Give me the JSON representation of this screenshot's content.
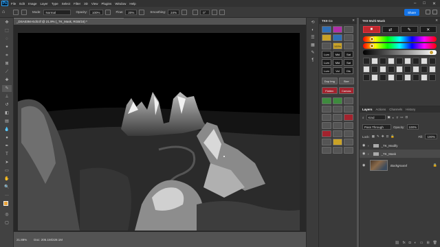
{
  "menubar": {
    "logo": "Ps",
    "items": [
      "File",
      "Edit",
      "Image",
      "Layer",
      "Type",
      "Select",
      "Filter",
      "3D",
      "View",
      "Plugins",
      "Window",
      "Help"
    ]
  },
  "options": {
    "mode_label": "Mode:",
    "mode_value": "Normal",
    "opacity_label": "Opacity:",
    "opacity_value": "100%",
    "flow_label": "Flow:",
    "flow_value": "20%",
    "smoothing_label": "Smoothing:",
    "smoothing_value": "24%",
    "angle_value": "0°",
    "share_label": "Share"
  },
  "document": {
    "tab_title": "_DSA0394-Edit.tif @ 21.9% (_TK_Mask, RGB/16) *"
  },
  "status": {
    "zoom": "21.88%",
    "doc_size": "Doc: 205.1M/228.1M"
  },
  "tk9co": {
    "title": "TK9 Co",
    "buttons": [
      "",
      "",
      "",
      "",
      "",
      "",
      "",
      "100%",
      "",
      "Lum",
      "Mid",
      "Sat",
      "Lum",
      "Mid",
      "Sat",
      "Lum",
      "Vol",
      "Dis"
    ],
    "wide1": [
      "Dup Img",
      "Size"
    ],
    "wide2": [
      "Flatten",
      "Canvas"
    ]
  },
  "multimask": {
    "title": "TK9 Multi-Mask"
  },
  "layers": {
    "tabs": [
      "Layers",
      "Actions",
      "Channels",
      "History"
    ],
    "kind_label": "Kind",
    "blend_mode": "Pass Through",
    "opacity_label": "Opacity:",
    "opacity_value": "100%",
    "lock_label": "Lock:",
    "fill_label": "Fill:",
    "fill_value": "100%",
    "items": [
      {
        "name": "_TK_Modify",
        "type": "group"
      },
      {
        "name": "_TK_Mask",
        "type": "group"
      },
      {
        "name": "Background",
        "type": "image"
      }
    ]
  },
  "colors": {
    "accent": "#1473e6",
    "panel": "#3a3a3a",
    "canvas_bg": "#000000"
  }
}
